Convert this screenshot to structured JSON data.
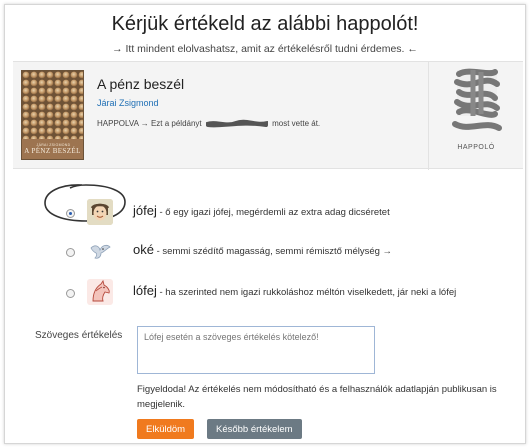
{
  "header": {
    "title": "Kérjük értékeld az alábbi happolót!",
    "subtitle": "→ Itt mindent elolvashatsz, amit az értékelésről tudni érdemes. ←"
  },
  "book": {
    "title": "A pénz beszél",
    "author": "Járai Zsigmond",
    "cover_title": "A PÉNZ BESZÉL",
    "cover_author": "JÁRAI ZSIGMOND",
    "happolva_prefix": "HAPPOLVA → Ezt a példányt",
    "happolva_suffix": "most vette át.",
    "happolo_label": "HAPPOLÓ"
  },
  "rating": {
    "selected": "jofej",
    "options": [
      {
        "id": "jofej",
        "label": "jófej",
        "text": " - ő egy igazi jófej, megérdemli az extra adag dicséretet",
        "icon": "smiling-face-icon",
        "checked": true
      },
      {
        "id": "oke",
        "label": "oké",
        "text": " - semmi szédítő magasság, semmi rémisztő mélység →",
        "icon": "bird-icon",
        "checked": false
      },
      {
        "id": "lofej",
        "label": "lófej",
        "text": " - ha szerinted nem igazi rukkoláshoz méltón viselkedett, jár neki a lófej",
        "icon": "horse-head-icon",
        "checked": false
      }
    ]
  },
  "text_review": {
    "label": "Szöveges értékelés",
    "placeholder": "Lófej esetén a szöveges értékelés kötelező!",
    "value": ""
  },
  "warning": "Figyeldoda! Az értékelés nem módosítható és a felhasználók adatlapján publikusan is megjelenik.",
  "buttons": {
    "send": "Elküldöm",
    "later": "Később értékelem"
  },
  "colors": {
    "accent_orange": "#f07a1e",
    "secondary_gray": "#6c7a84",
    "link_blue": "#1f6fb5",
    "radio_blue": "#2a5db0"
  }
}
